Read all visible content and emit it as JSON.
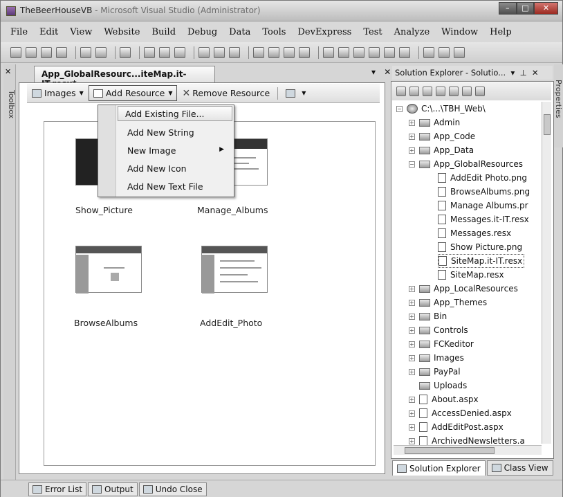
{
  "window": {
    "title_main": "TheBeerHouseVB",
    "title_rest": " - Microsoft Visual Studio (Administrator)"
  },
  "menu": [
    "File",
    "Edit",
    "View",
    "Website",
    "Build",
    "Debug",
    "Data",
    "Tools",
    "DevExpress",
    "Test",
    "Analyze",
    "Window",
    "Help"
  ],
  "toolbox_label": "Toolbox",
  "properties_label": "Properties",
  "document": {
    "tab_title": "App_GlobalResourc...iteMap.it-IT.resx*",
    "pin": "▾",
    "close": "✕"
  },
  "resource_toolbar": {
    "images_label": "Images",
    "add_resource_label": "Add Resource",
    "remove_resource_label": "Remove Resource"
  },
  "dropdown": {
    "items": [
      "Add Existing File...",
      "Add New String",
      "New Image",
      "Add New Icon",
      "Add New Text File"
    ]
  },
  "resources": [
    {
      "label": "Show_Picture"
    },
    {
      "label": "Manage_Albums"
    },
    {
      "label": "BrowseAlbums"
    },
    {
      "label": "AddEdit_Photo"
    }
  ],
  "solution_explorer": {
    "title": "Solution Explorer - Solutio...",
    "root": "C:\\...\\TBH_Web\\",
    "folders_top": [
      "Admin",
      "App_Code",
      "App_Data",
      "App_GlobalResources"
    ],
    "global_resources_files": [
      "AddEdit Photo.png",
      "BrowseAlbums.png",
      "Manage Albums.pr",
      "Messages.it-IT.resx",
      "Messages.resx",
      "Show Picture.png",
      "SiteMap.it-IT.resx",
      "SiteMap.resx"
    ],
    "folders_bottom": [
      "App_LocalResources",
      "App_Themes",
      "Bin",
      "Controls",
      "FCKeditor",
      "Images",
      "PayPal",
      "Uploads"
    ],
    "files": [
      "About.aspx",
      "AccessDenied.aspx",
      "AddEditPost.aspx",
      "ArchivedNewsletters.a"
    ],
    "tab_solution": "Solution Explorer",
    "tab_class": "Class View"
  },
  "status_tabs": [
    "Error List",
    "Output",
    "Undo Close"
  ]
}
